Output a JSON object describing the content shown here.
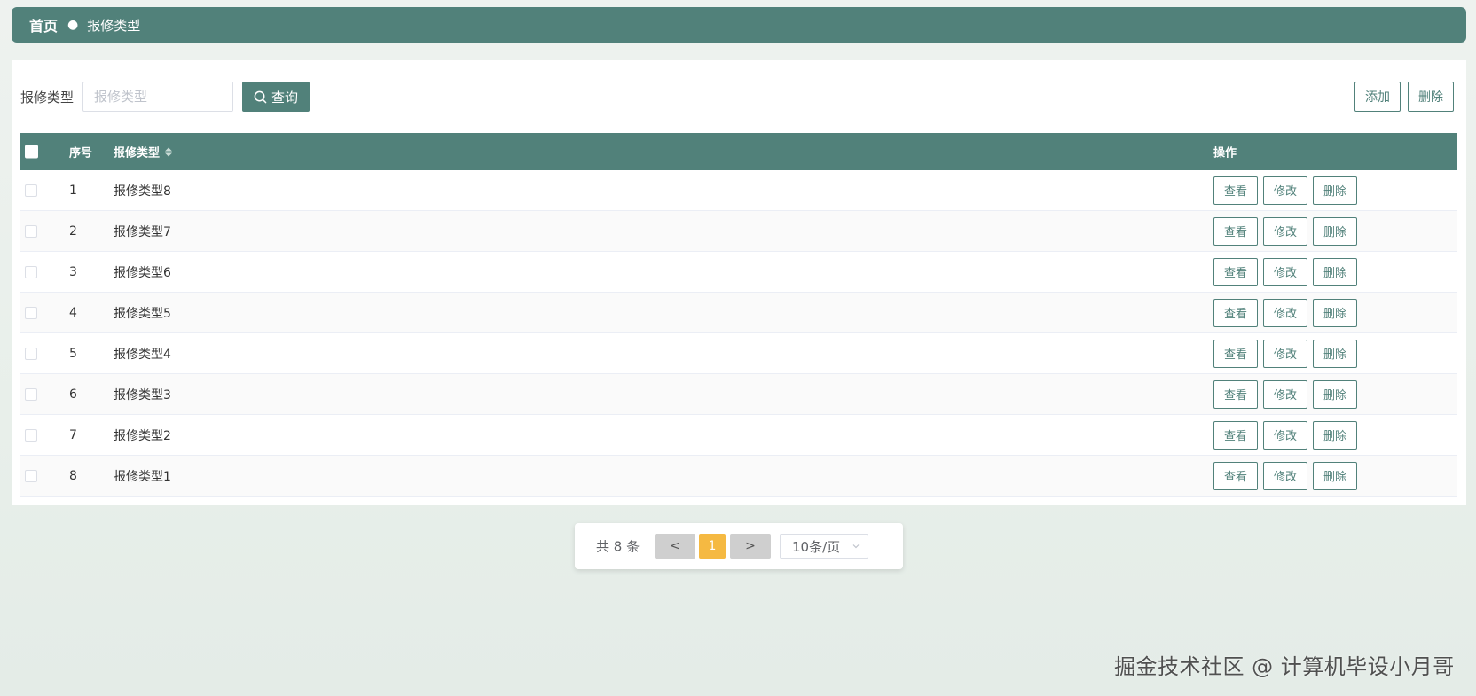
{
  "breadcrumb": {
    "home": "首页",
    "separator": "●",
    "current": "报修类型"
  },
  "search": {
    "label": "报修类型",
    "placeholder": "报修类型",
    "value": "",
    "query_label": "查询"
  },
  "actions": {
    "add_label": "添加",
    "delete_label": "删除"
  },
  "table": {
    "columns": {
      "index": "序号",
      "type": "报修类型",
      "ops": "操作"
    },
    "row_actions": {
      "view": "查看",
      "edit": "修改",
      "delete": "删除"
    },
    "rows": [
      {
        "index": "1",
        "type": "报修类型8"
      },
      {
        "index": "2",
        "type": "报修类型7"
      },
      {
        "index": "3",
        "type": "报修类型6"
      },
      {
        "index": "4",
        "type": "报修类型5"
      },
      {
        "index": "5",
        "type": "报修类型4"
      },
      {
        "index": "6",
        "type": "报修类型3"
      },
      {
        "index": "7",
        "type": "报修类型2"
      },
      {
        "index": "8",
        "type": "报修类型1"
      }
    ]
  },
  "pagination": {
    "total_text": "共 8 条",
    "prev": "<",
    "current_page": "1",
    "next": ">",
    "page_size": "10条/页"
  },
  "watermark": "掘金技术社区 @ 计算机毕设小月哥",
  "colors": {
    "primary": "#51817a",
    "active_page": "#f5b942",
    "background": "#eef2ef"
  }
}
